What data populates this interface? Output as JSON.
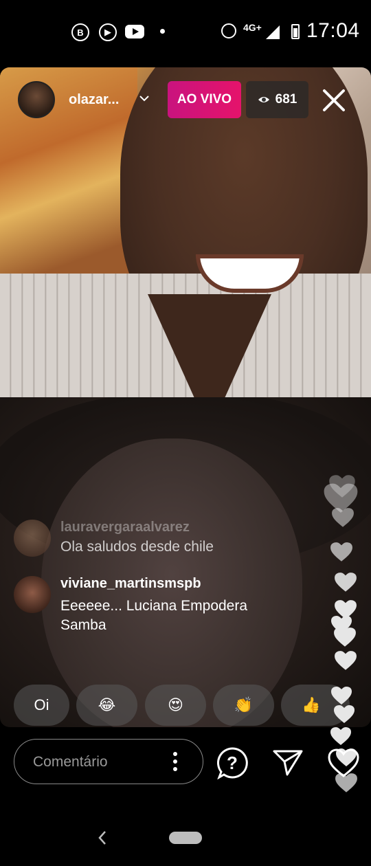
{
  "status_bar": {
    "time": "17:04",
    "network": "4G+",
    "icons": [
      "whatsapp-business-icon",
      "play-icon",
      "youtube-icon",
      "dot-icon",
      "alarm-icon",
      "signal-icon",
      "battery-icon"
    ]
  },
  "live_header": {
    "host_username": "olazar...",
    "live_badge": "AO VIVO",
    "viewer_count": "681",
    "live_color": "#d8126f"
  },
  "comments": [
    {
      "username": "lauravergaraalvarez",
      "text": "Ola saludos desde chile"
    },
    {
      "username": "viviane_martinsmspb",
      "text": "Eeeeee... Luciana Empodera Samba"
    }
  ],
  "quick_reactions": [
    "Oi",
    "😂",
    "😍",
    "👏",
    "👍"
  ],
  "composer": {
    "placeholder": "Comentário"
  }
}
